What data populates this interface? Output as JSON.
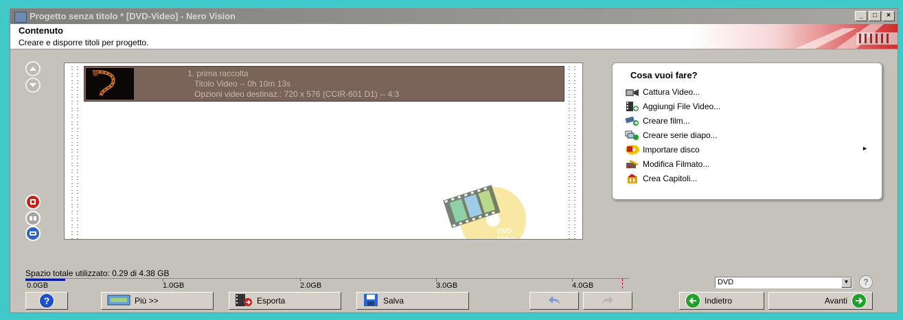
{
  "window": {
    "title": "Progetto senza titolo * [DVD-Video] - Nero Vision",
    "buttons": {
      "minimize": "_",
      "maximize": "□",
      "close": "×"
    }
  },
  "header": {
    "title": "Contenuto",
    "subtitle": "Creare e disporre titoli per progetto."
  },
  "content": {
    "items": [
      {
        "line1": "1. prima raccolta",
        "line2": "Titolo Video -- 0h 10m 13s",
        "line3": "Opzioni video destinaz.: 720 x 576 (CCIR-601 D1) -- 4:3"
      }
    ],
    "watermark_label": "DVD-Video"
  },
  "action_panel": {
    "title": "Cosa vuoi fare?",
    "items": [
      {
        "label": "Cattura Video...",
        "icon": "camera-icon"
      },
      {
        "label": "Aggiungi File Video...",
        "icon": "add-video-file-icon"
      },
      {
        "label": "Creare film...",
        "icon": "create-movie-icon"
      },
      {
        "label": "Creare serie diapo...",
        "icon": "slideshow-icon"
      },
      {
        "label": "Importare disco",
        "icon": "import-disc-icon",
        "submenu": "►"
      },
      {
        "label": "Modifica Filmato...",
        "icon": "edit-movie-icon"
      },
      {
        "label": "Crea Capitoli...",
        "icon": "chapters-icon"
      }
    ]
  },
  "space": {
    "label": "Spazio totale utilizzato: 0.29 di 4.38 GB",
    "used_gb": 0.29,
    "total_gb": 4.38,
    "ticks": [
      "0.0GB",
      "1.0GB",
      "2.0GB",
      "3.0GB",
      "4.0GB"
    ]
  },
  "disc_type": {
    "selected": "DVD"
  },
  "buttons": {
    "more": "Più >>",
    "export": "Esporta",
    "save": "Salva",
    "back": "Indietro",
    "next": "Avanti"
  },
  "colors": {
    "accent_blue": "#1c4fc8",
    "green": "#1fa12a",
    "red": "#c81e1e"
  }
}
